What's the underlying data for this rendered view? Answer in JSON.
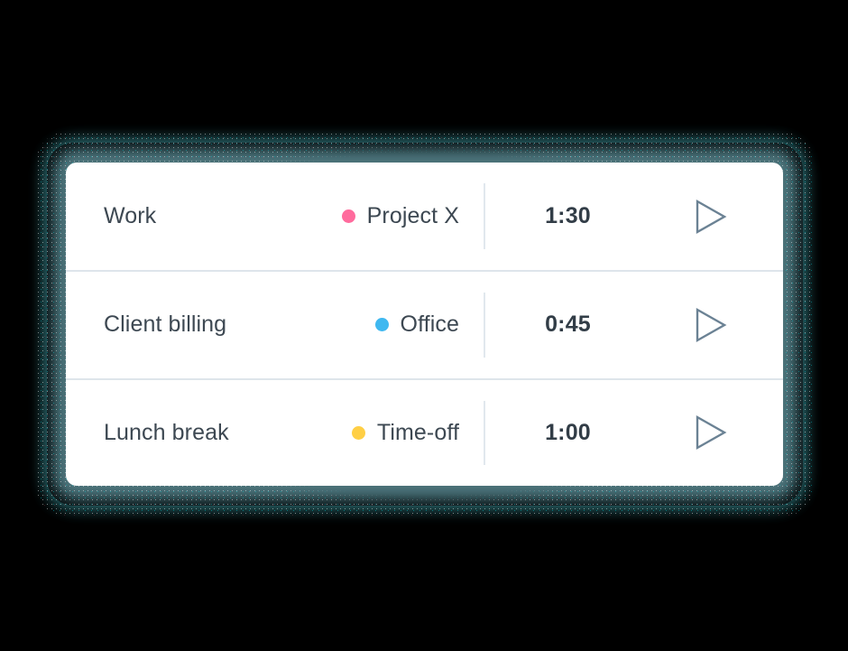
{
  "background_color": "#000000",
  "card": {
    "background_color": "#ffffff",
    "divider_color": "#dee5eb",
    "glow_color": "#40ced6",
    "text_color": "#3d4852",
    "time_color": "#323d47",
    "play_icon_color": "#6b8294"
  },
  "rows": [
    {
      "task": "Work",
      "category": "Project X",
      "dot_color": "#ff6b9d",
      "duration": "1:30",
      "play_label": "play-icon"
    },
    {
      "task": "Client billing",
      "category": "Office",
      "dot_color": "#3fb8f0",
      "duration": "0:45",
      "play_label": "play-icon"
    },
    {
      "task": "Lunch break",
      "category": "Time-off",
      "dot_color": "#ffcf45",
      "duration": "1:00",
      "play_label": "play-icon"
    }
  ]
}
